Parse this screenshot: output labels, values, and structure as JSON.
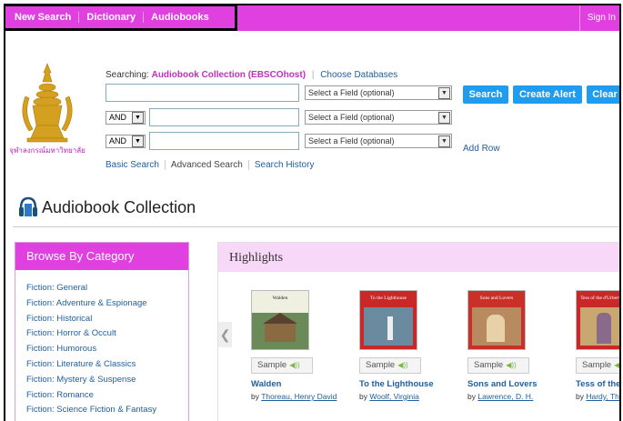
{
  "topnav": {
    "new_search": "New Search",
    "dictionary": "Dictionary",
    "audiobooks": "Audiobooks",
    "sign_in": "Sign In"
  },
  "search": {
    "searching_label": "Searching:",
    "database": "Audiobook Collection (EBSCOhost)",
    "choose_databases": "Choose Databases",
    "field_placeholder": "Select a Field (optional)",
    "bool_op": "AND",
    "search_button": "Search",
    "create_alert_button": "Create Alert",
    "clear_button": "Clear",
    "add_row": "Add Row",
    "basic_search": "Basic Search",
    "advanced_search": "Advanced Search",
    "search_history": "Search History"
  },
  "logo_caption": "จุฬาลงกรณ์มหาวิทยาลัย",
  "collection_title": "Audiobook Collection",
  "browse": {
    "heading": "Browse By Category",
    "items": [
      "Fiction: General",
      "Fiction: Adventure & Espionage",
      "Fiction: Historical",
      "Fiction: Horror & Occult",
      "Fiction: Humorous",
      "Fiction: Literature & Classics",
      "Fiction: Mystery & Suspense",
      "Fiction: Romance",
      "Fiction: Science Fiction & Fantasy"
    ]
  },
  "highlights": {
    "heading": "Highlights",
    "sample_label": "Sample",
    "books": [
      {
        "title": "Walden",
        "by": "by",
        "author": "Thoreau, Henry David",
        "cover_text": "Walden",
        "color": "#3a6a3a"
      },
      {
        "title": "To the Lighthouse",
        "by": "by",
        "author": "Woolf, Virginia",
        "cover_text": "To the Lighthouse",
        "color": "#c82828"
      },
      {
        "title": "Sons and Lovers",
        "by": "by",
        "author": "Lawrence, D. H.",
        "cover_text": "Sons and Lovers",
        "color": "#c83028"
      },
      {
        "title": "Tess of the D'Urbervilles",
        "by": "by",
        "author": "Hardy, Thomas",
        "cover_text": "Tess of the d'Urbervilles",
        "color": "#c82828"
      }
    ]
  },
  "colors": {
    "brand_magenta": "#e040e0",
    "button_blue": "#1e9cf0",
    "link_blue": "#2060a0"
  }
}
